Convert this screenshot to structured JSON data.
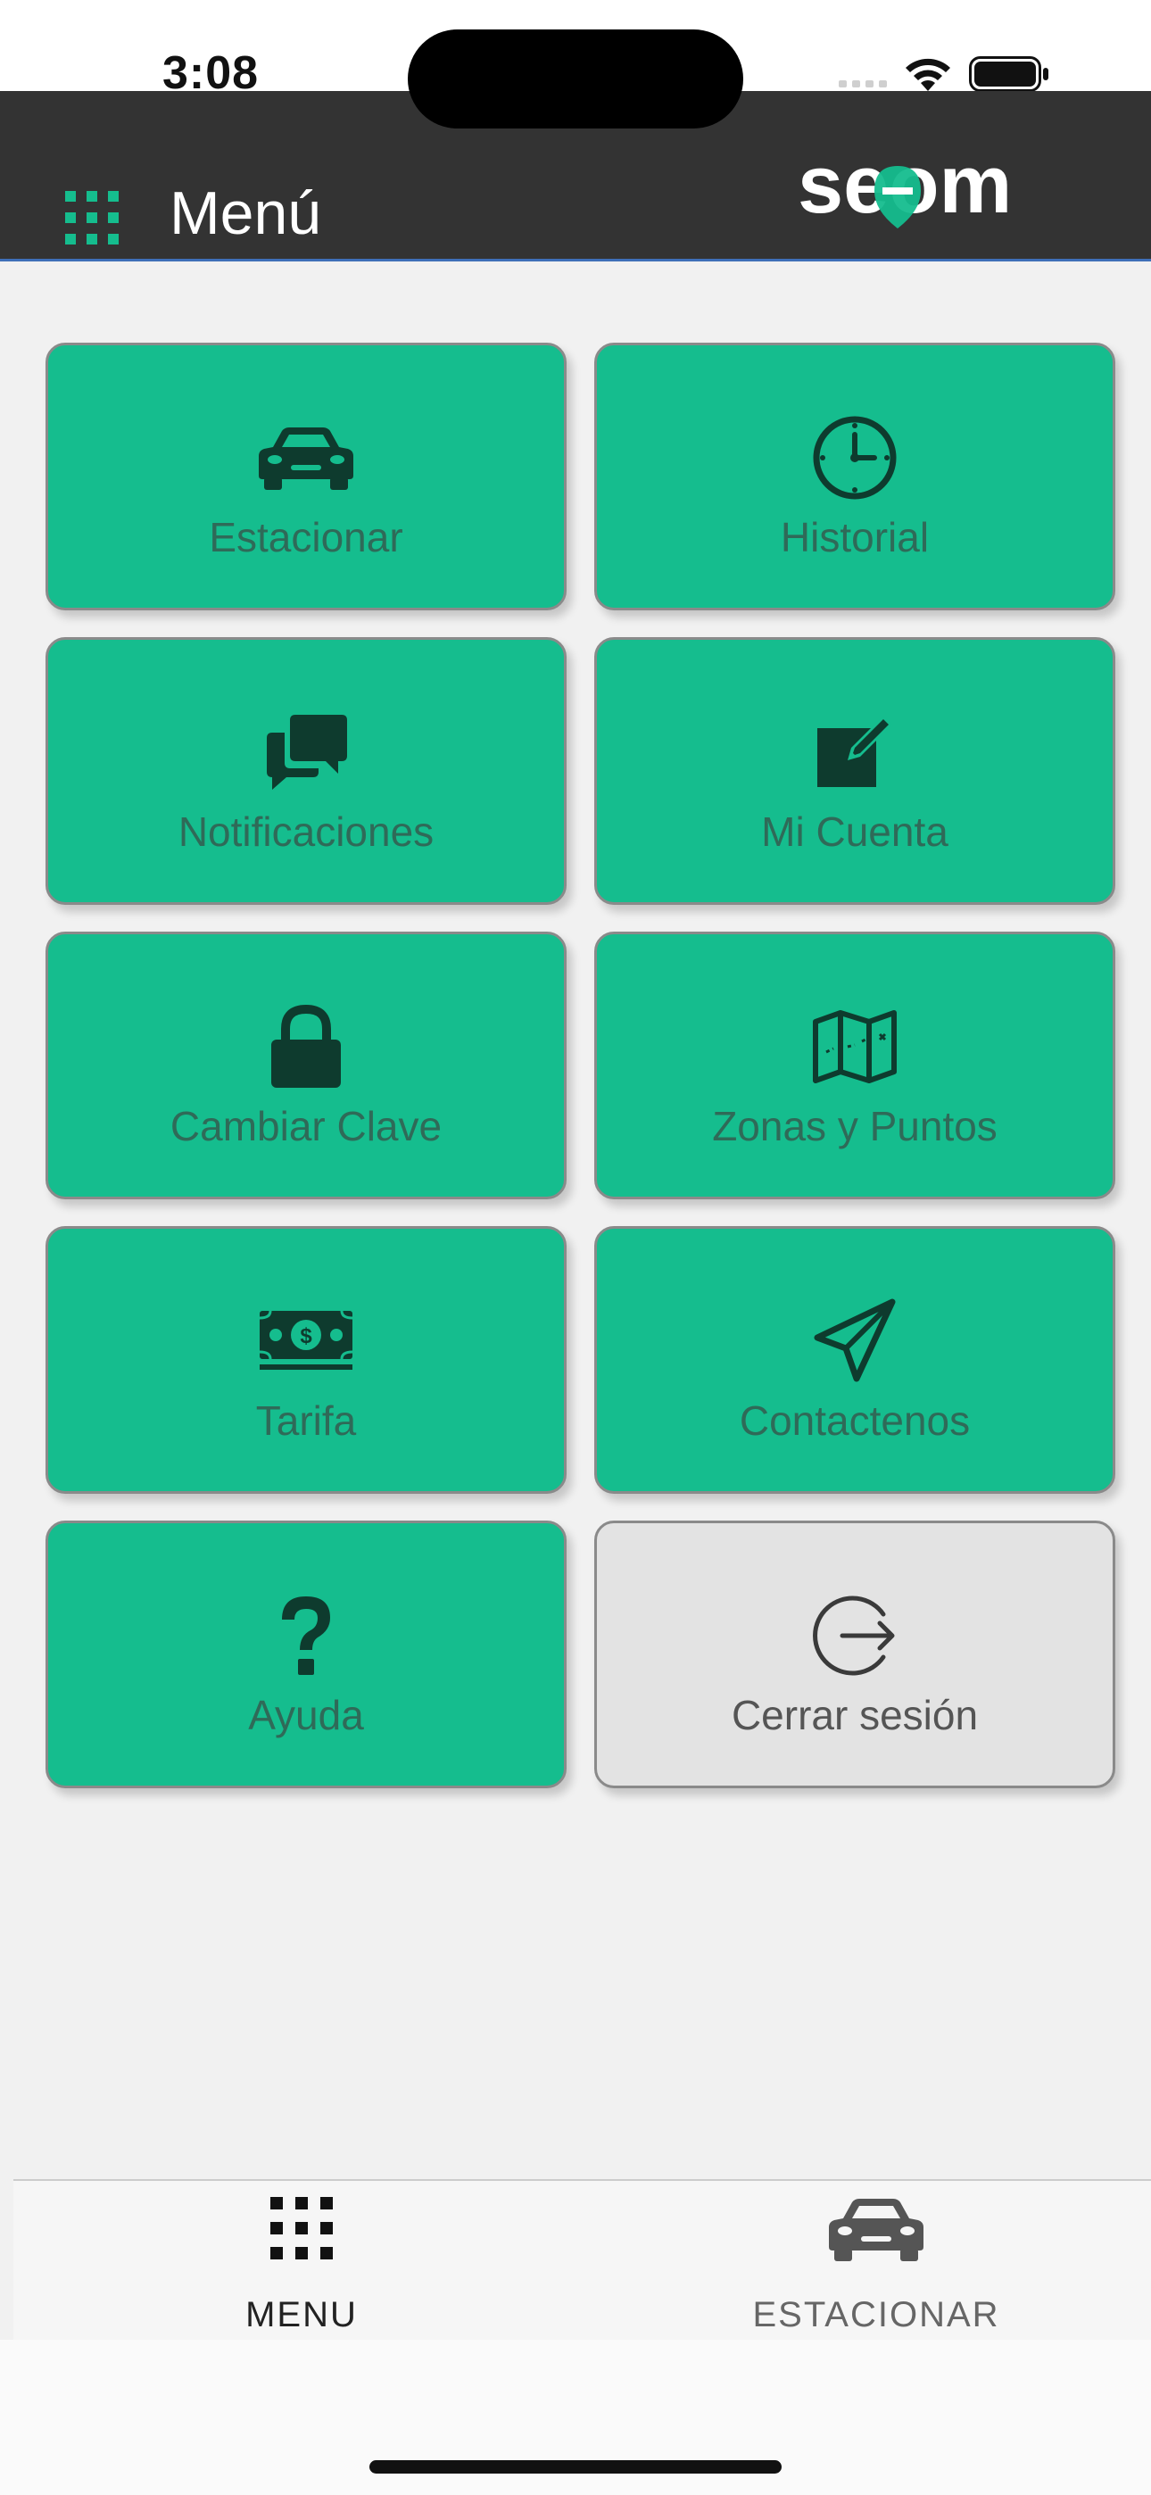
{
  "status_bar": {
    "time": "3:08"
  },
  "header": {
    "title": "Menú",
    "logo_text": "seom"
  },
  "tiles": [
    {
      "label": "Estacionar",
      "icon": "car-icon"
    },
    {
      "label": "Historial",
      "icon": "clock-icon"
    },
    {
      "label": "Notificaciones",
      "icon": "chat-bubbles-icon"
    },
    {
      "label": "Mi Cuenta",
      "icon": "edit-square-icon"
    },
    {
      "label": "Cambiar Clave",
      "icon": "lock-icon"
    },
    {
      "label": "Zonas y Puntos",
      "icon": "map-icon"
    },
    {
      "label": "Tarifa",
      "icon": "money-bill-icon"
    },
    {
      "label": "Contactenos",
      "icon": "paper-plane-icon"
    },
    {
      "label": "Ayuda",
      "icon": "question-icon"
    },
    {
      "label": "Cerrar sesión",
      "icon": "logout-icon"
    }
  ],
  "bottom_nav": [
    {
      "label": "MENU",
      "icon": "grid-icon",
      "active": true
    },
    {
      "label": "ESTACIONAR",
      "icon": "car-icon",
      "active": false
    }
  ],
  "colors": {
    "header_bg": "#333333",
    "accent_green": "#15bd8e",
    "tile_text": "#2f6a58",
    "logout_tile_bg": "#e3e3e3",
    "page_bg": "#f1f1f1"
  }
}
